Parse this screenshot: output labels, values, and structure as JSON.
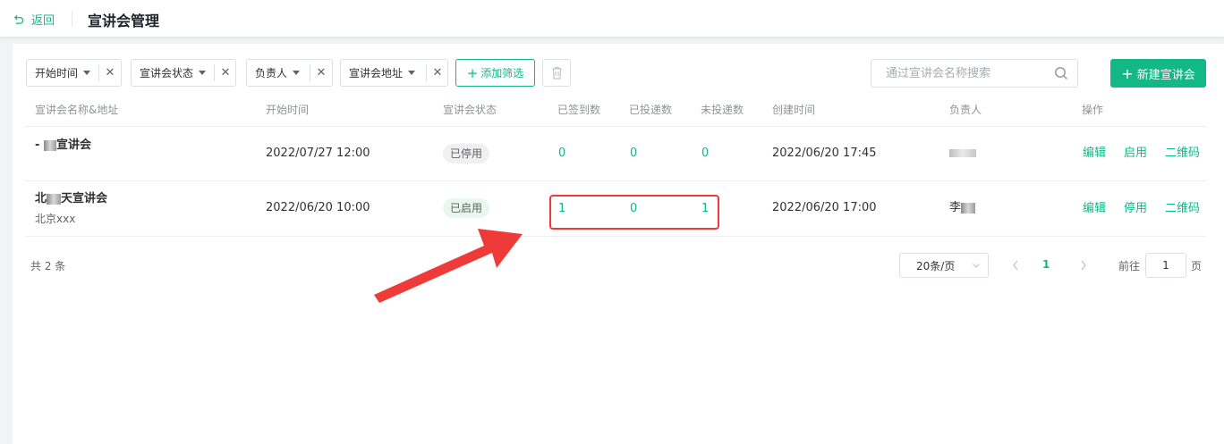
{
  "header": {
    "back_label": "返回",
    "title": "宣讲会管理"
  },
  "filters": [
    {
      "label": "开始时间"
    },
    {
      "label": "宣讲会状态"
    },
    {
      "label": "负责人"
    },
    {
      "label": "宣讲会地址"
    }
  ],
  "toolbar": {
    "add_filter_label": "添加筛选",
    "search_placeholder": "通过宣讲会名称搜索",
    "new_button_label": "新建宣讲会"
  },
  "table": {
    "columns": [
      "宣讲会名称&地址",
      "开始时间",
      "宣讲会状态",
      "已签到数",
      "已投递数",
      "未投递数",
      "创建时间",
      "负责人",
      "操作"
    ],
    "rows": [
      {
        "name_prefix": "-",
        "name_suffix": "宣讲会",
        "address": "",
        "start_time": "2022/07/27 12:00",
        "status": "已停用",
        "signed": "0",
        "delivered": "0",
        "undelivered": "0",
        "created": "2022/06/20 17:45",
        "owner": "",
        "actions": [
          "编辑",
          "启用",
          "二维码"
        ]
      },
      {
        "name_prefix": "北",
        "name_suffix": "天宣讲会",
        "address": "北京xxx",
        "start_time": "2022/06/20 10:00",
        "status": "已启用",
        "signed": "1",
        "delivered": "0",
        "undelivered": "1",
        "created": "2022/06/20 17:00",
        "owner": "李",
        "actions": [
          "编辑",
          "停用",
          "二维码"
        ]
      }
    ]
  },
  "pagination": {
    "total_text": "共 2 条",
    "page_size": "20条/页",
    "current_page": "1",
    "goto_label": "前往",
    "goto_value": "1",
    "page_suffix": "页"
  },
  "colors": {
    "accent": "#12b886",
    "highlight": "#ef3a3a"
  }
}
